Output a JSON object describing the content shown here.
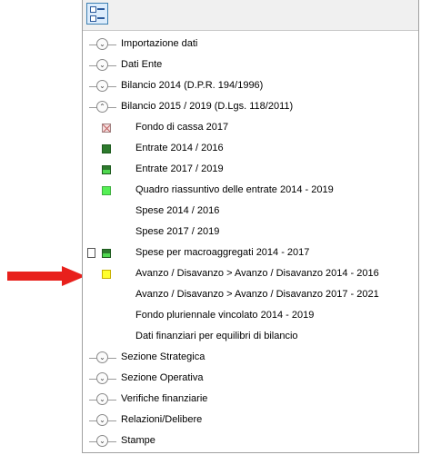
{
  "colors": {
    "arrow": "#e8201c",
    "icon_dark_green": "#2d7a2d",
    "icon_light_green": "#55ef55",
    "icon_yellow": "#ffff2e",
    "icon_cross": "#c06060",
    "toolbar_button": "#dcecfc"
  },
  "toolbar": {
    "button_icon": "list-view-icon"
  },
  "tree": {
    "importazione": {
      "label": "Importazione dati",
      "state": "collapsed"
    },
    "dati_ente": {
      "label": "Dati Ente",
      "state": "collapsed"
    },
    "bilancio_2014": {
      "label": "Bilancio 2014 (D.P.R. 194/1996)",
      "state": "collapsed"
    },
    "bilancio_2015": {
      "label": "Bilancio 2015 / 2019 (D.Lgs. 118/2011)",
      "state": "expanded",
      "children": [
        {
          "label": "Fondo di cassa 2017",
          "icon": "cross-icon"
        },
        {
          "label": "Entrate 2014 / 2016",
          "icon": "dark-green-square-icon"
        },
        {
          "label": "Entrate 2017 / 2019",
          "icon": "half-green-square-icon"
        },
        {
          "label": "Quadro riassuntivo delle entrate 2014 - 2019",
          "icon": "light-green-square-icon"
        },
        {
          "label": "Spese 2014 / 2016",
          "icon": ""
        },
        {
          "label": "Spese 2017 / 2019",
          "icon": ""
        },
        {
          "label": "Spese per macroaggregati 2014 - 2017",
          "icon": "half-green-square-icon",
          "extra_icon": "document-icon"
        },
        {
          "label": "Avanzo / Disavanzo > Avanzo / Disavanzo 2014 - 2016",
          "icon": "yellow-square-icon",
          "highlighted_by_arrow": true
        },
        {
          "label": "Avanzo / Disavanzo > Avanzo / Disavanzo 2017 - 2021",
          "icon": ""
        },
        {
          "label": "Fondo pluriennale vincolato 2014 - 2019",
          "icon": ""
        },
        {
          "label": "Dati finanziari per equilibri di bilancio",
          "icon": ""
        }
      ]
    },
    "sezione_strategica": {
      "label": "Sezione Strategica",
      "state": "collapsed"
    },
    "sezione_operativa": {
      "label": "Sezione Operativa",
      "state": "collapsed"
    },
    "verifiche": {
      "label": "Verifiche finanziarie",
      "state": "collapsed"
    },
    "relazioni": {
      "label": "Relazioni/Delibere",
      "state": "collapsed"
    },
    "stampe": {
      "label": "Stampe",
      "state": "collapsed"
    }
  }
}
